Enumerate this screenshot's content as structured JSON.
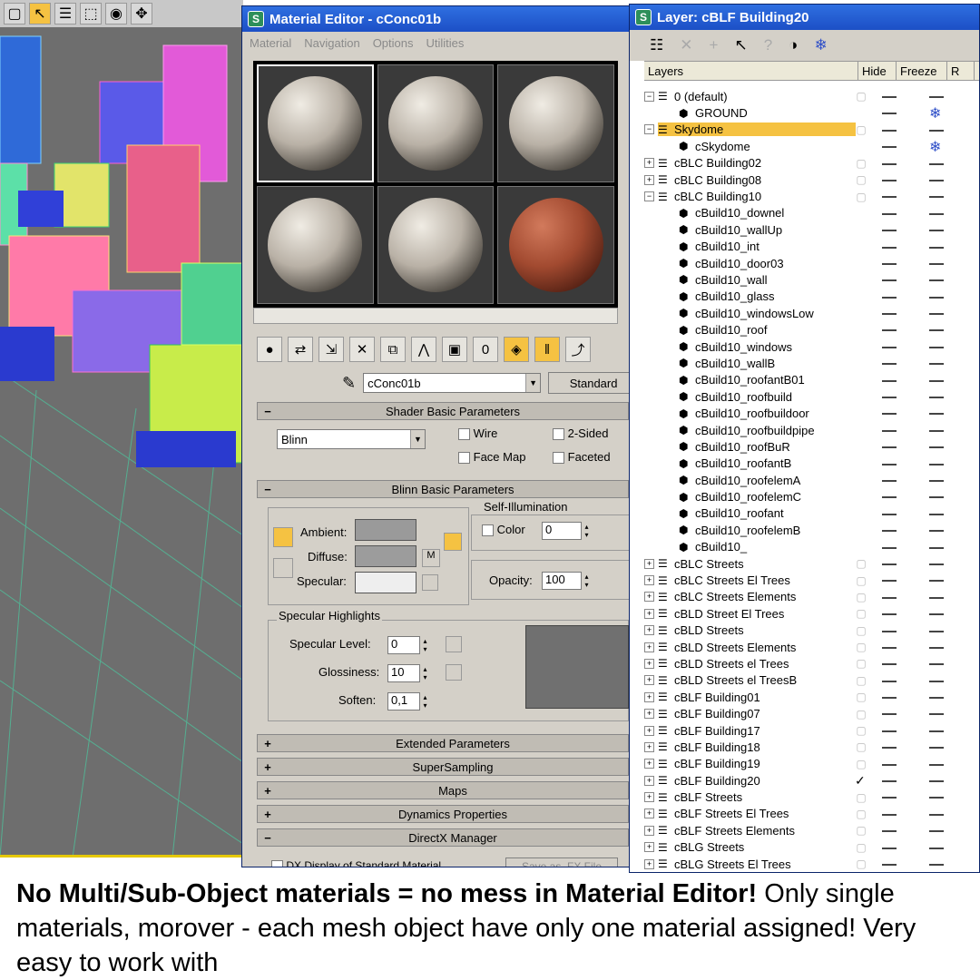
{
  "material_editor": {
    "title": "Material Editor - cConc01b",
    "menu": [
      "Material",
      "Navigation",
      "Options",
      "Utilities"
    ],
    "material_name": "cConc01b",
    "type_button": "Standard",
    "rollouts": {
      "shader_basic": "Shader Basic Parameters",
      "blinn_basic": "Blinn Basic Parameters",
      "extended": "Extended Parameters",
      "supersampling": "SuperSampling",
      "maps": "Maps",
      "dynamics": "Dynamics Properties",
      "directx": "DirectX Manager"
    },
    "shader": {
      "type": "Blinn",
      "wire": "Wire",
      "two_sided": "2-Sided",
      "face_map": "Face Map",
      "faceted": "Faceted"
    },
    "blinn": {
      "ambient": "Ambient:",
      "diffuse": "Diffuse:",
      "specular": "Specular:",
      "m_button": "M",
      "self_illum_title": "Self-Illumination",
      "color_label": "Color",
      "color_value": "0",
      "opacity_label": "Opacity:",
      "opacity_value": "100",
      "ambient_color": "#9a9a9a",
      "diffuse_color": "#9c9c9c",
      "specular_color": "#eeeeee"
    },
    "specular_highlights": {
      "title": "Specular Highlights",
      "level_label": "Specular Level:",
      "level_value": "0",
      "gloss_label": "Glossiness:",
      "gloss_value": "10",
      "soften_label": "Soften:",
      "soften_value": "0,1"
    },
    "directx": {
      "dx_display": "DX Display of Standard Material",
      "save_fx": "Save as .FX File"
    }
  },
  "layer_manager": {
    "title": "Layer: cBLF Building20",
    "columns": [
      "Layers",
      "Hide",
      "Freeze",
      "R"
    ],
    "rows": [
      {
        "name": "0 (default)",
        "type": "layer",
        "exp": "−"
      },
      {
        "name": "GROUND",
        "type": "object",
        "freeze_icon": "snowflake-icon"
      },
      {
        "name": "Skydome",
        "type": "layer",
        "exp": "−",
        "selected": true
      },
      {
        "name": "cSkydome",
        "type": "object",
        "freeze_icon": "snowflake-icon"
      },
      {
        "name": "cBLC Building02",
        "type": "layer",
        "exp": "+"
      },
      {
        "name": "cBLC Building08",
        "type": "layer",
        "exp": "+"
      },
      {
        "name": "cBLC Building10",
        "type": "layer",
        "exp": "−"
      },
      {
        "name": "cBuild10_downel",
        "type": "object"
      },
      {
        "name": "cBuild10_wallUp",
        "type": "object"
      },
      {
        "name": "cBuild10_int",
        "type": "object"
      },
      {
        "name": "cBuild10_door03",
        "type": "object"
      },
      {
        "name": "cBuild10_wall",
        "type": "object"
      },
      {
        "name": "cBuild10_glass",
        "type": "object"
      },
      {
        "name": "cBuild10_windowsLow",
        "type": "object"
      },
      {
        "name": "cBuild10_roof",
        "type": "object"
      },
      {
        "name": "cBuild10_windows",
        "type": "object"
      },
      {
        "name": "cBuild10_wallB",
        "type": "object"
      },
      {
        "name": "cBuild10_roofantB01",
        "type": "object"
      },
      {
        "name": "cBuild10_roofbuild",
        "type": "object"
      },
      {
        "name": "cBuild10_roofbuildoor",
        "type": "object"
      },
      {
        "name": "cBuild10_roofbuildpipe",
        "type": "object"
      },
      {
        "name": "cBuild10_roofBuR",
        "type": "object"
      },
      {
        "name": "cBuild10_roofantB",
        "type": "object"
      },
      {
        "name": "cBuild10_roofelemA",
        "type": "object"
      },
      {
        "name": "cBuild10_roofelemC",
        "type": "object"
      },
      {
        "name": "cBuild10_roofant",
        "type": "object"
      },
      {
        "name": "cBuild10_roofelemB",
        "type": "object"
      },
      {
        "name": "cBuild10_",
        "type": "object"
      },
      {
        "name": "cBLC Streets",
        "type": "layer",
        "exp": "+"
      },
      {
        "name": "cBLC Streets El Trees",
        "type": "layer",
        "exp": "+"
      },
      {
        "name": "cBLC Streets Elements",
        "type": "layer",
        "exp": "+"
      },
      {
        "name": "cBLD Street El Trees",
        "type": "layer",
        "exp": "+"
      },
      {
        "name": "cBLD Streets",
        "type": "layer",
        "exp": "+"
      },
      {
        "name": "cBLD Streets Elements",
        "type": "layer",
        "exp": "+"
      },
      {
        "name": "cBLD Streets el Trees",
        "type": "layer",
        "exp": "+"
      },
      {
        "name": "cBLD Streets el TreesB",
        "type": "layer",
        "exp": "+"
      },
      {
        "name": "cBLF Building01",
        "type": "layer",
        "exp": "+"
      },
      {
        "name": "cBLF Building07",
        "type": "layer",
        "exp": "+"
      },
      {
        "name": "cBLF Building17",
        "type": "layer",
        "exp": "+"
      },
      {
        "name": "cBLF Building18",
        "type": "layer",
        "exp": "+"
      },
      {
        "name": "cBLF Building19",
        "type": "layer",
        "exp": "+"
      },
      {
        "name": "cBLF Building20",
        "type": "layer",
        "exp": "+",
        "current": true
      },
      {
        "name": "cBLF Streets",
        "type": "layer",
        "exp": "+"
      },
      {
        "name": "cBLF Streets El Trees",
        "type": "layer",
        "exp": "+"
      },
      {
        "name": "cBLF Streets Elements",
        "type": "layer",
        "exp": "+"
      },
      {
        "name": "cBLG Streets",
        "type": "layer",
        "exp": "+"
      },
      {
        "name": "cBLG Streets El Trees",
        "type": "layer",
        "exp": "+"
      }
    ]
  },
  "caption": {
    "bold": "No Multi/Sub-Object materials = no mess in Material Editor!",
    "normal": " Only single materials, morover - each mesh object have only one material assigned! Very easy to work with"
  },
  "colors": {
    "accent_yellow": "#f5c242",
    "title_blue": "#1c4fc6"
  }
}
